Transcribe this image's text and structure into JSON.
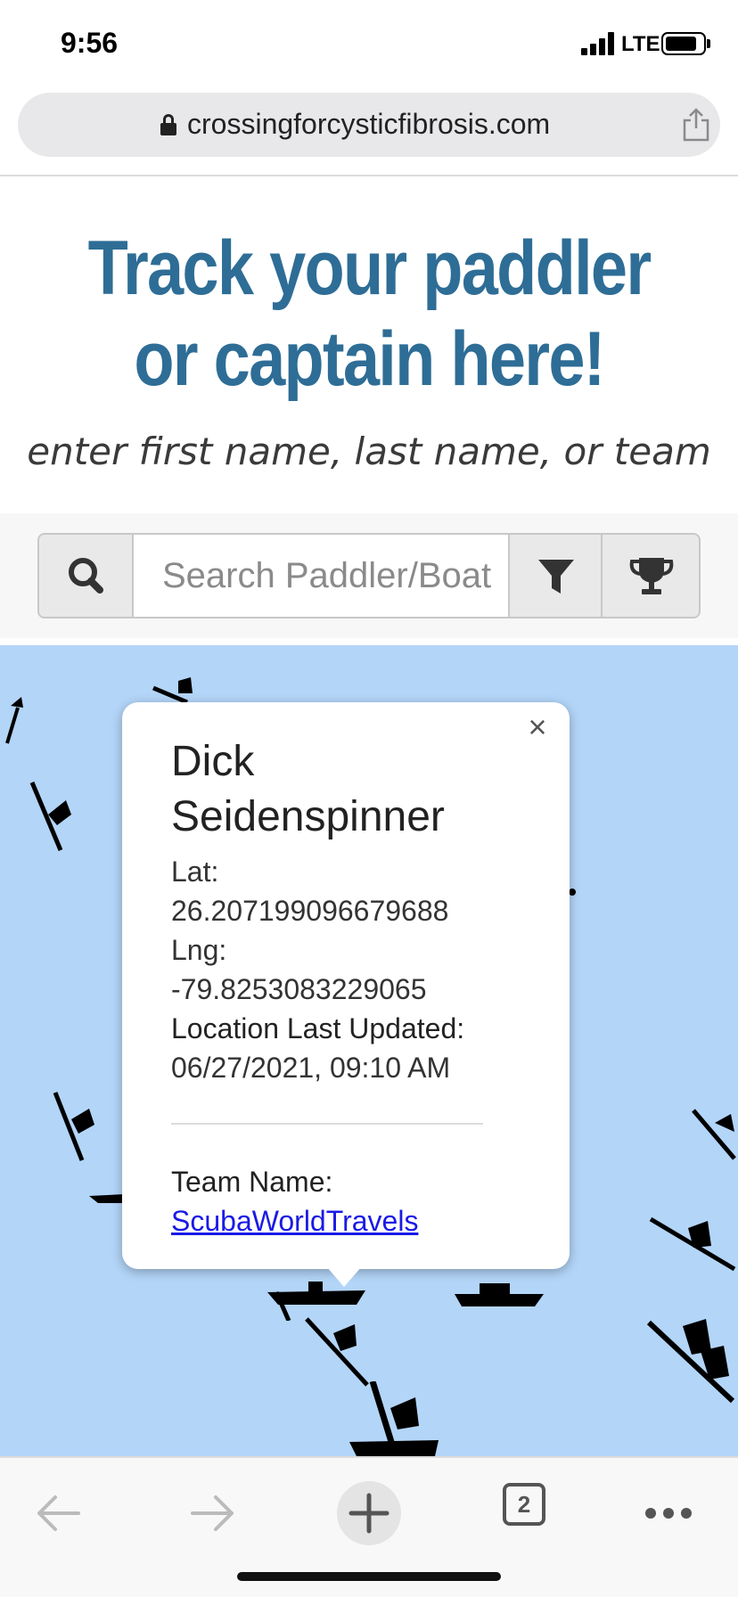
{
  "status_bar": {
    "time": "9:56",
    "network": "LTE",
    "icons": [
      "signal-icon",
      "battery-icon"
    ]
  },
  "browser": {
    "url": "crossingforcysticfibrosis.com",
    "tab_count": "2",
    "icons": [
      "lock-icon",
      "share-icon",
      "back-icon",
      "forward-icon",
      "new-tab-icon",
      "tabs-icon",
      "more-icon"
    ]
  },
  "page": {
    "headline_line1": "Track your paddler",
    "headline_line2": "or captain here!",
    "subhead": "enter first name, last name, or team",
    "search": {
      "placeholder": "Search Paddler/Boat",
      "icons": [
        "search-icon",
        "filter-icon",
        "trophy-icon"
      ]
    }
  },
  "popup": {
    "name": "Dick Seidenspinner",
    "lat_label": "Lat:",
    "lat_value": "26.207199096679688",
    "lng_label": "Lng:",
    "lng_value": "-79.8253083229065",
    "updated_label": "Location Last Updated:",
    "updated_value": "06/27/2021, 09:10 AM",
    "team_label": "Team Name:",
    "team_value": "ScubaWorldTravels",
    "close_symbol": "×"
  },
  "colors": {
    "headline": "#2e6d96",
    "map_water": "#b3d5f8",
    "link": "#1a1ae6"
  }
}
